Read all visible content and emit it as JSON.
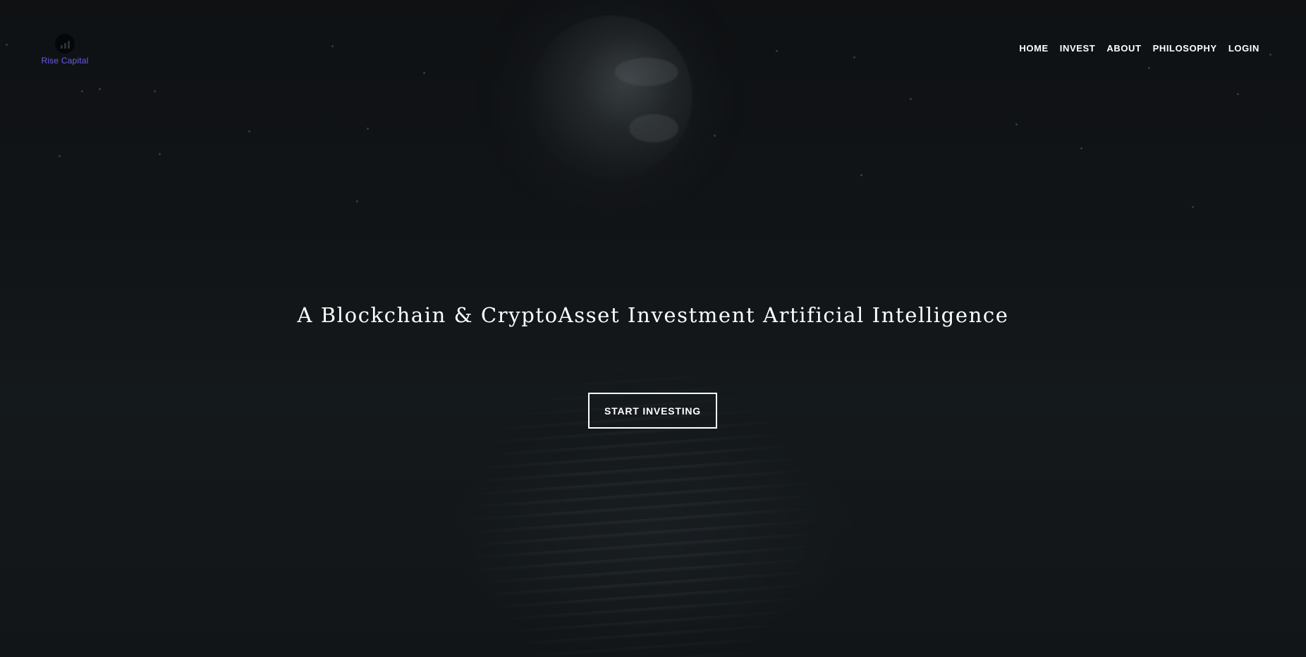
{
  "brand": {
    "name": "Rise Capital",
    "logo_icon": "bar-chart-icon",
    "text_color": "#6a5cf0"
  },
  "nav": {
    "items": [
      {
        "label": "HOME"
      },
      {
        "label": "INVEST"
      },
      {
        "label": "ABOUT"
      },
      {
        "label": "PHILOSOPHY"
      },
      {
        "label": "LOGIN"
      }
    ]
  },
  "hero": {
    "headline": "A Blockchain & CryptoAsset Investment Artificial Intelligence",
    "cta_label": "START INVESTING"
  }
}
